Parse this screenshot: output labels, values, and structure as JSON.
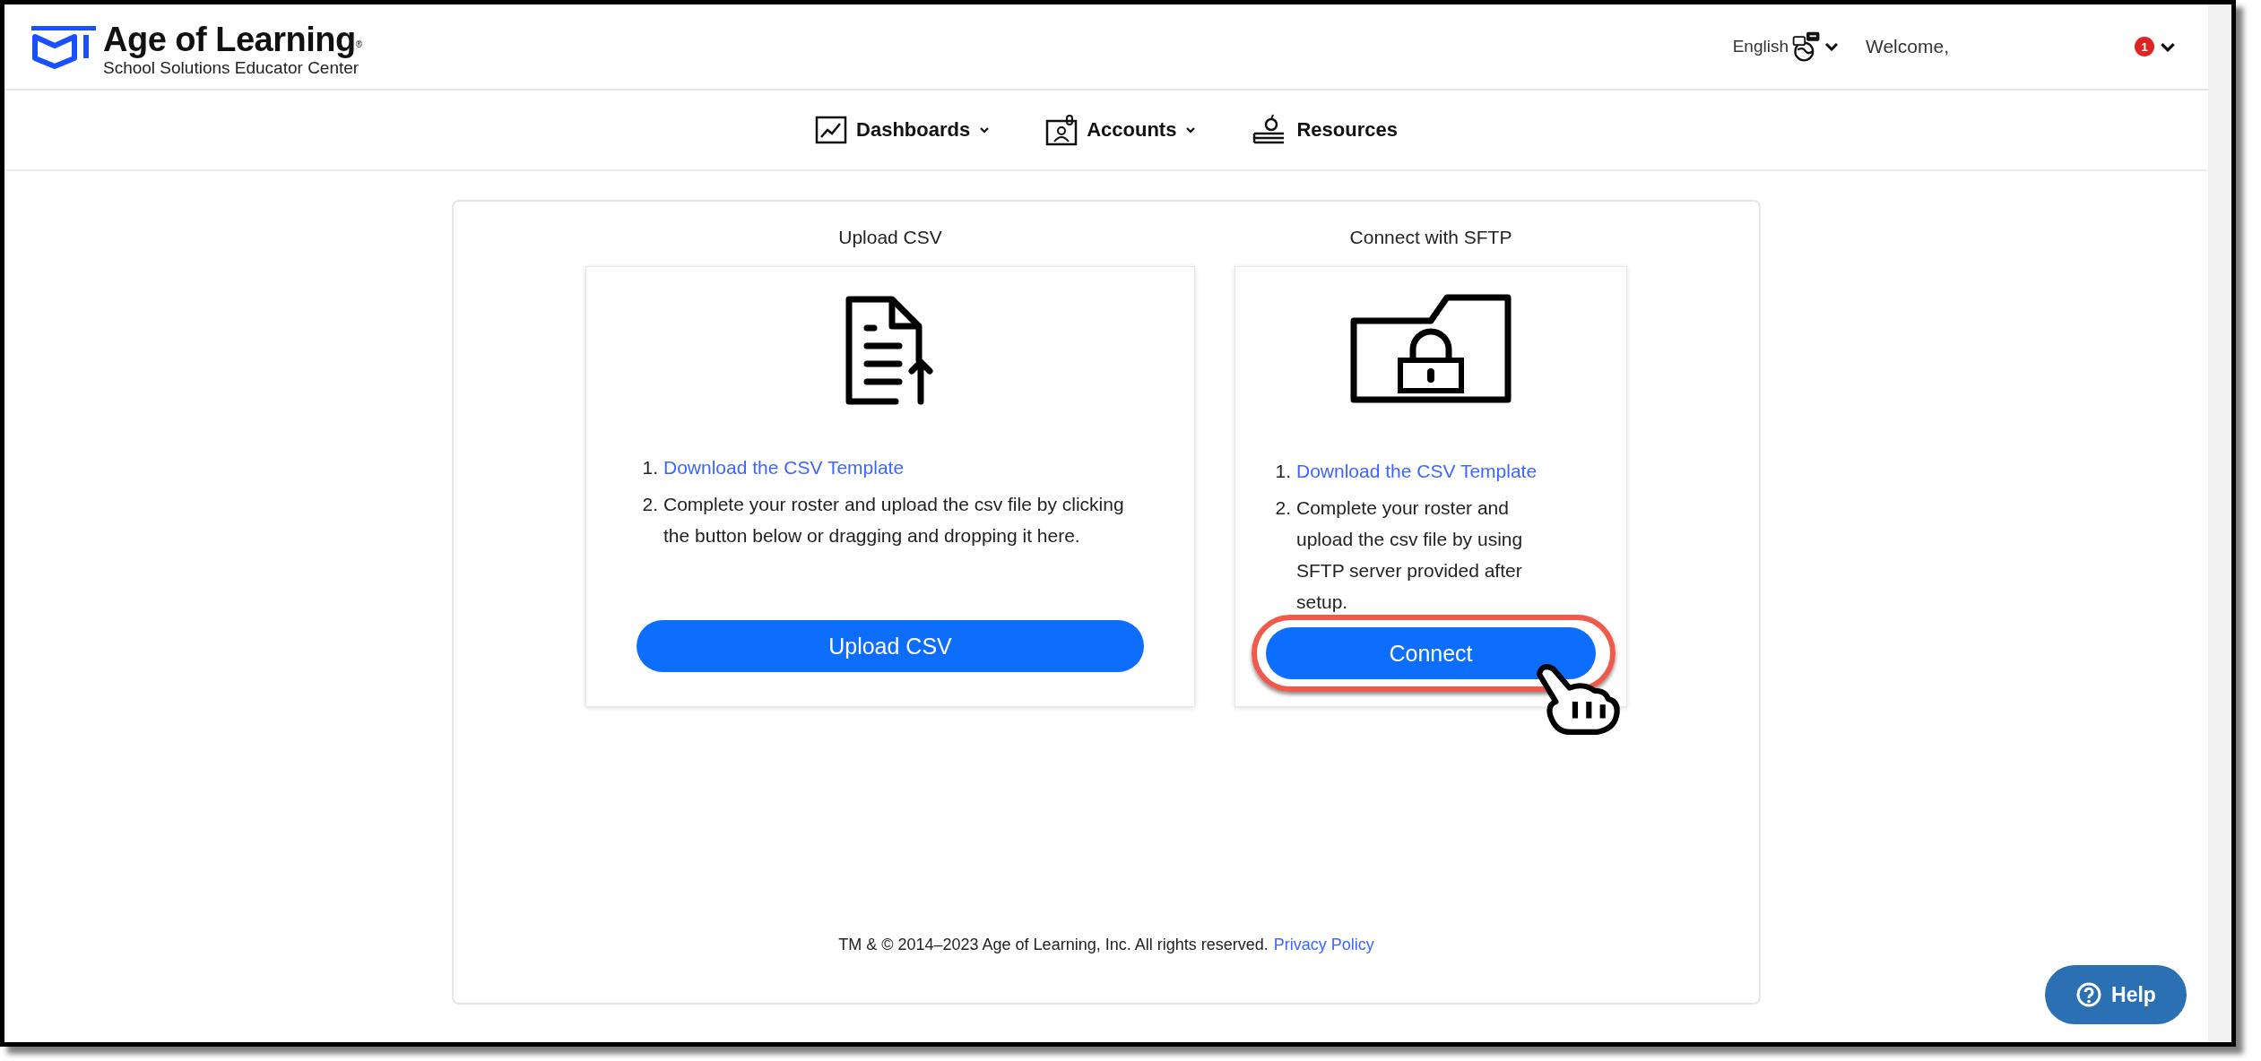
{
  "header": {
    "logo_title": "Age of Learning",
    "logo_mark": "®",
    "logo_subtitle": "School Solutions Educator Center",
    "language": "English",
    "welcome": "Welcome,",
    "notification_count": "1"
  },
  "nav": [
    {
      "label": "Dashboards",
      "kind": "chart",
      "dropdown": true
    },
    {
      "label": "Accounts",
      "kind": "contact",
      "dropdown": true
    },
    {
      "label": "Resources",
      "kind": "books",
      "dropdown": false
    }
  ],
  "sections": [
    {
      "title": "Upload CSV",
      "kind": "upload",
      "steps": [
        {
          "number": "1.",
          "kind": "link",
          "text": "Download the CSV Template"
        },
        {
          "number": "2.",
          "kind": "text",
          "text": "Complete your roster and upload the csv file by clicking the button below or dragging and dropping it here."
        }
      ],
      "button": "Upload CSV",
      "highlighted": false
    },
    {
      "title": "Connect with SFTP",
      "kind": "sftp",
      "steps": [
        {
          "number": "1.",
          "kind": "link",
          "text": "Download the CSV Template"
        },
        {
          "number": "2.",
          "kind": "text",
          "text": "Complete your roster and upload the csv file by using SFTP server provided after setup."
        }
      ],
      "button": "Connect",
      "highlighted": true
    }
  ],
  "footer": {
    "text": "TM & © 2014–2023 Age of Learning, Inc. All rights reserved.",
    "link": "Privacy Policy"
  },
  "help": "Help"
}
